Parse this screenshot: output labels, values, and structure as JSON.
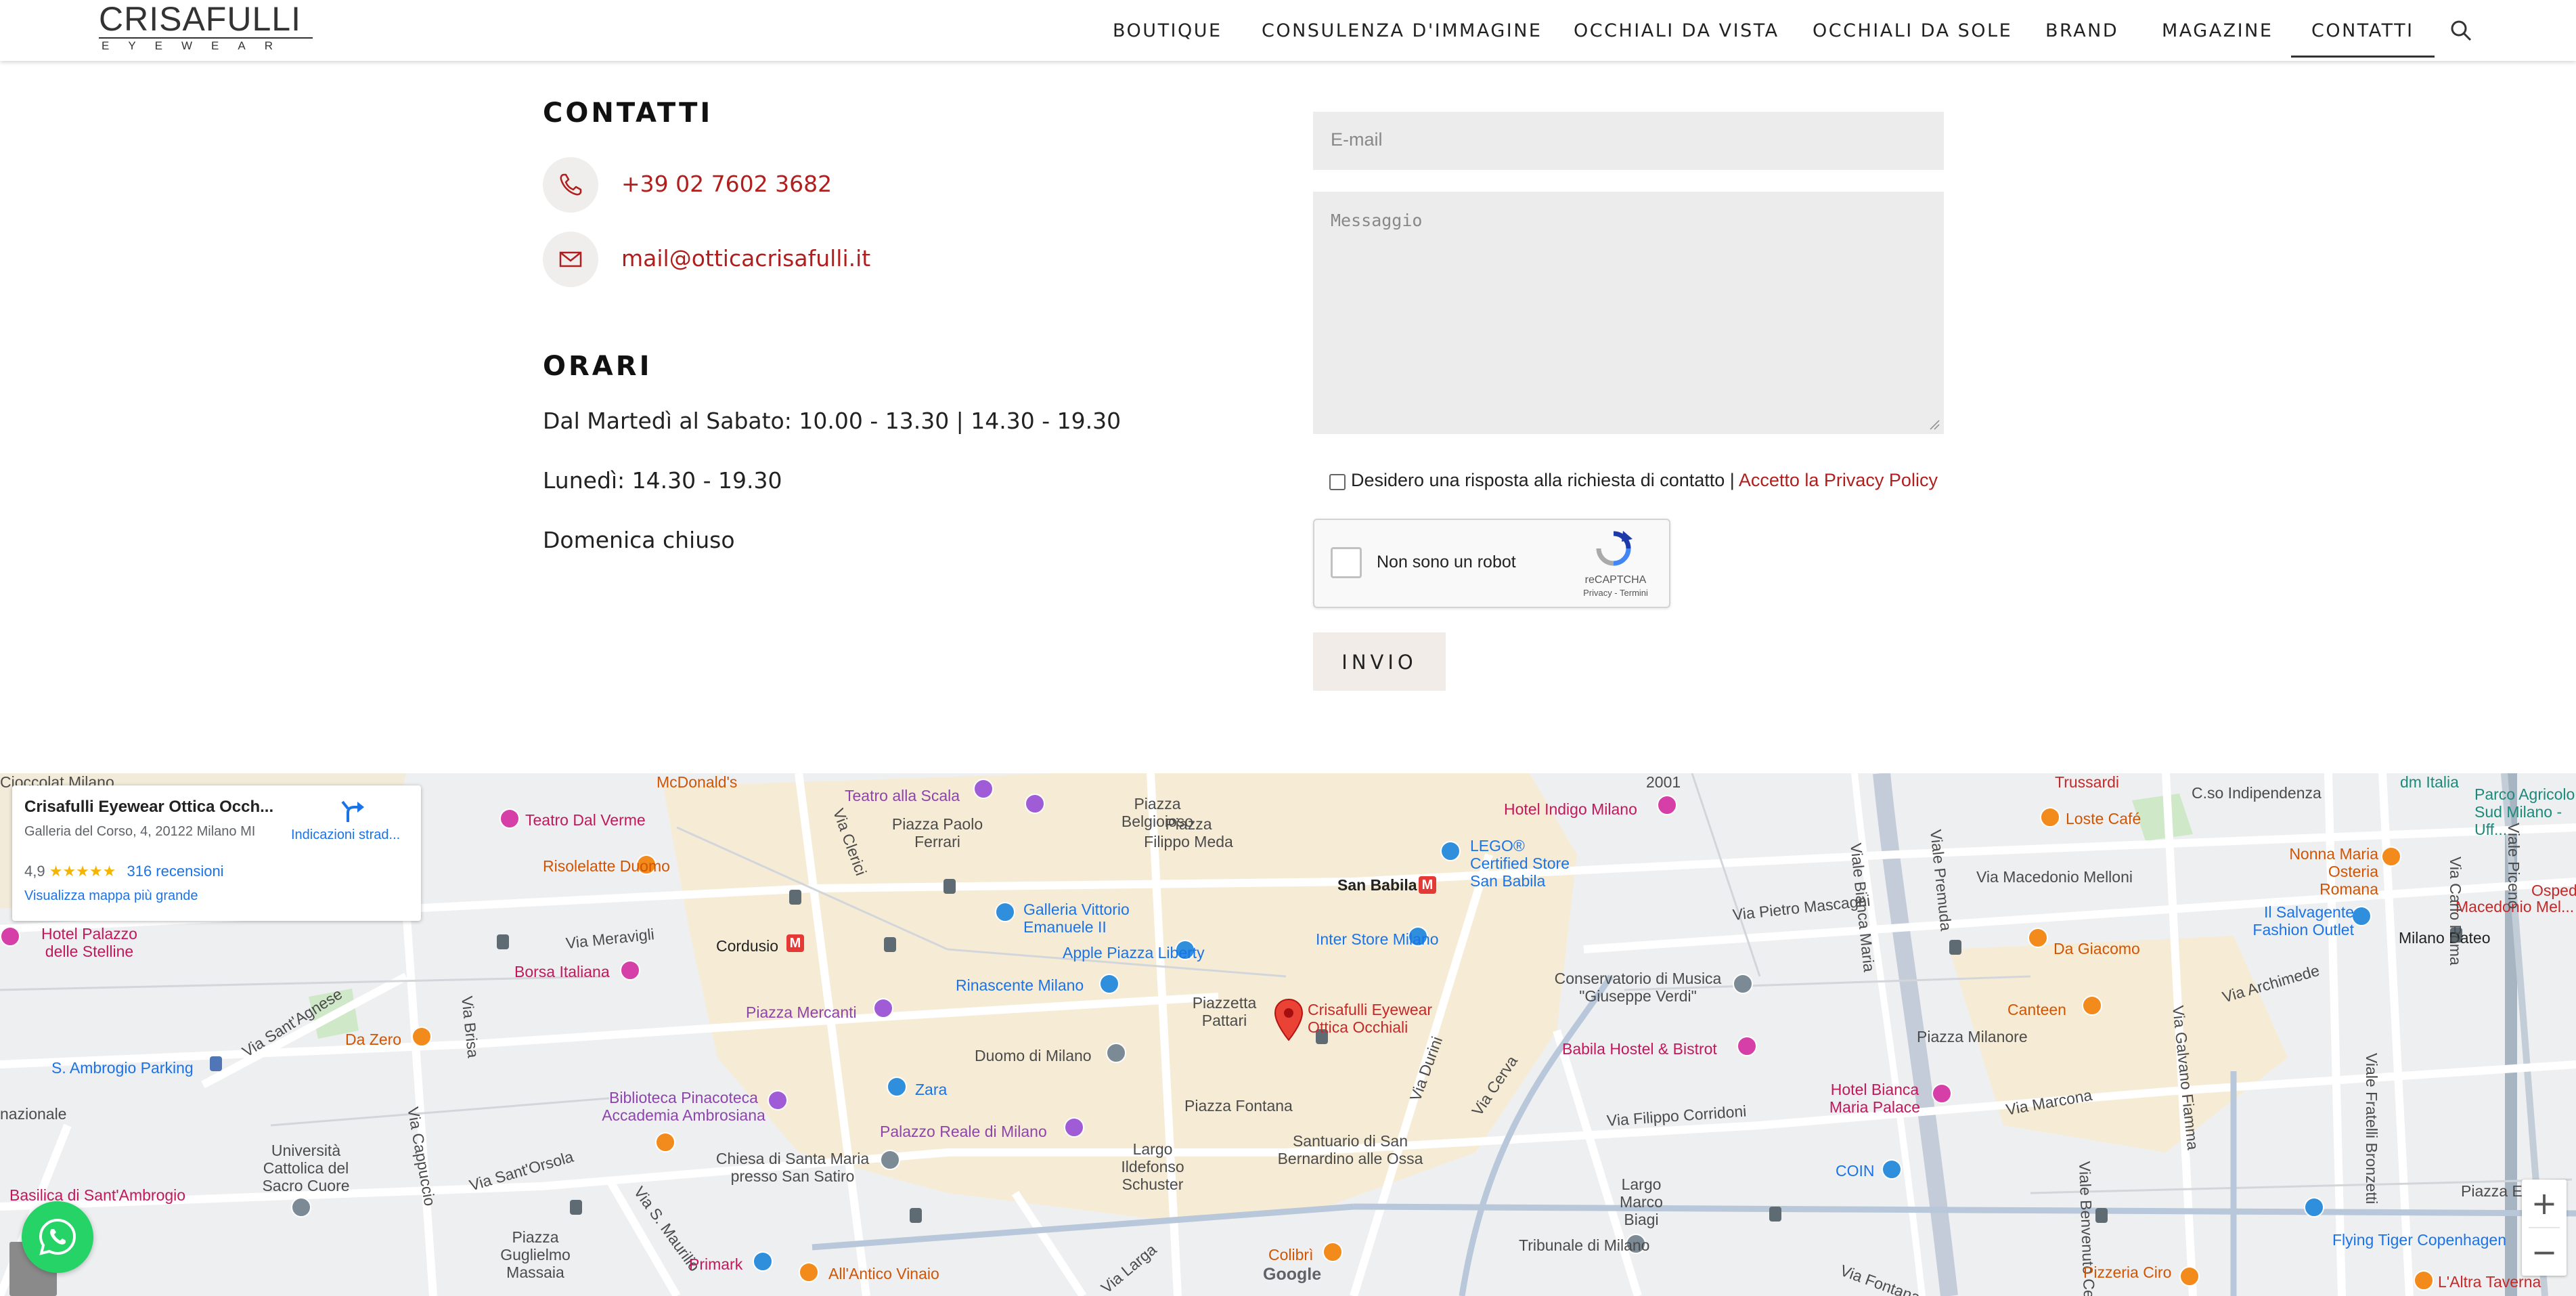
{
  "header": {
    "logo_main": "CRISAFULLI",
    "logo_sub": "EYEWEAR",
    "nav": [
      {
        "label": "BOUTIQUE"
      },
      {
        "label": "CONSULENZA D'IMMAGINE"
      },
      {
        "label": "OCCHIALI DA VISTA"
      },
      {
        "label": "OCCHIALI DA SOLE"
      },
      {
        "label": "BRAND"
      },
      {
        "label": "MAGAZINE"
      },
      {
        "label": "CONTATTI",
        "active": true
      }
    ],
    "search_icon": "search-icon"
  },
  "contacts": {
    "title": "CONTATTI",
    "phone": "+39 02 7602 3682",
    "email": "mail@otticacrisafulli.it",
    "phone_icon": "phone-icon",
    "email_icon": "envelope-icon"
  },
  "hours": {
    "title": "ORARI",
    "lines": [
      "Dal Martedì al Sabato: 10.00 - 13.30 | 14.30 - 19.30",
      "Lunedì: 14.30 - 19.30",
      "Domenica chiuso"
    ]
  },
  "form": {
    "email_placeholder": "E-mail",
    "message_placeholder": "Messaggio",
    "consent_text": "Desidero una risposta alla richiesta di contatto |",
    "consent_link": "Accetto la Privacy Policy",
    "recaptcha_label": "Non sono un robot",
    "recaptcha_brand": "reCAPTCHA",
    "recaptcha_terms": "Privacy - Termini",
    "submit_label": "INVIO"
  },
  "map": {
    "card": {
      "title": "Crisafulli Eyewear Ottica Occh...",
      "address": "Galleria del Corso, 4, 20122 Milano MI",
      "rating": "4,9",
      "stars": "★★★★★",
      "reviews": "316 recensioni",
      "larger_map": "Visualizza mappa più grande",
      "directions": "Indicazioni strad..."
    },
    "pin_label_line1": "Crisafulli Eyewear",
    "pin_label_line2": "Ottica Occhiali",
    "google_label": "Google",
    "zoom_in": "+",
    "zoom_out": "−",
    "labels": [
      "Cioccolat Milano",
      "McDonald's",
      "Teatro alla Scala",
      "Piazza Belgioioso",
      "2001",
      "Trussardi",
      "C.so Indipendenza",
      "dm Italia",
      "Parco Agricolo Sud Milano - Uff...",
      "Teatro Dal Verme",
      "Piazza Paolo Ferrari",
      "Piazza Filippo Meda",
      "Hotel Indigo Milano",
      "Loste Café",
      "Risolelatte Duomo",
      "Via Clerici",
      "LEGO® Certified Store San Babila",
      "Via Macedonio Melloni",
      "Nonna Maria Osteria Romana",
      "Ospedale",
      "Macedonio Mel...",
      "Galleria Vittorio Emanuele II",
      "San Babila",
      "Via Pietro Mascagni",
      "Viale Premuda",
      "Hotel Palazzo delle Stelline",
      "Via Meravigli",
      "Cordusio",
      "Apple Piazza Liberty",
      "Inter Store Milano",
      "Il Salvagente Fashion Outlet",
      "Milano Dateo",
      "Borsa Italiana",
      "Rinascente Milano",
      "Conservatorio di Musica \"Giuseppe Verdi\"",
      "Da Giacomo",
      "Via Archimede",
      "Via Sant'Agnese",
      "Piazza Mercanti",
      "Piazzetta Pattari",
      "Canteen",
      "Viale Piceno",
      "Via Carlo Poma",
      "Da Zero",
      "Duomo di Milano",
      "Piazza Milanore",
      "Viale Bianca Maria",
      "S. Ambrogio Parking",
      "Babila Hostel & Bistrot",
      "Via Galvano Fiamma",
      "Via Durini",
      "Via Cerva",
      "Via Brisa",
      "nazionale",
      "Biblioteca Pinacoteca Accademia Ambrosiana",
      "Zara",
      "Piazza Fontana",
      "Via Marcona",
      "Hotel Bianca Maria Palace",
      "Via Filippo Corridoni",
      "Viale Fratelli Bronzetti",
      "Via Cappuccio",
      "Palazzo Reale di Milano",
      "Università Cattolica del Sacro Cuore",
      "Via Sant'Orsola",
      "Chiesa di Santa Maria presso San Satiro",
      "Largo Ildefonso Schuster",
      "Santuario di San Bernardino alle Ossa",
      "COIN",
      "Piazza Emilia",
      "Basilica di Sant'Ambrogio",
      "Via S. Maurilio",
      "Largo Marco Biagi",
      "Viale Benvenuto Cellini",
      "Tribunale di Milano",
      "Flying Tiger Copenhagen",
      "Piazza Guglielmo Massaia",
      "Primark",
      "All'Antico Vinaio",
      "Via Larga",
      "Colibrì",
      "Via Fontana",
      "Pizzeria Ciro",
      "L'Altra Taverna"
    ]
  },
  "whatsapp_icon": "whatsapp-icon"
}
